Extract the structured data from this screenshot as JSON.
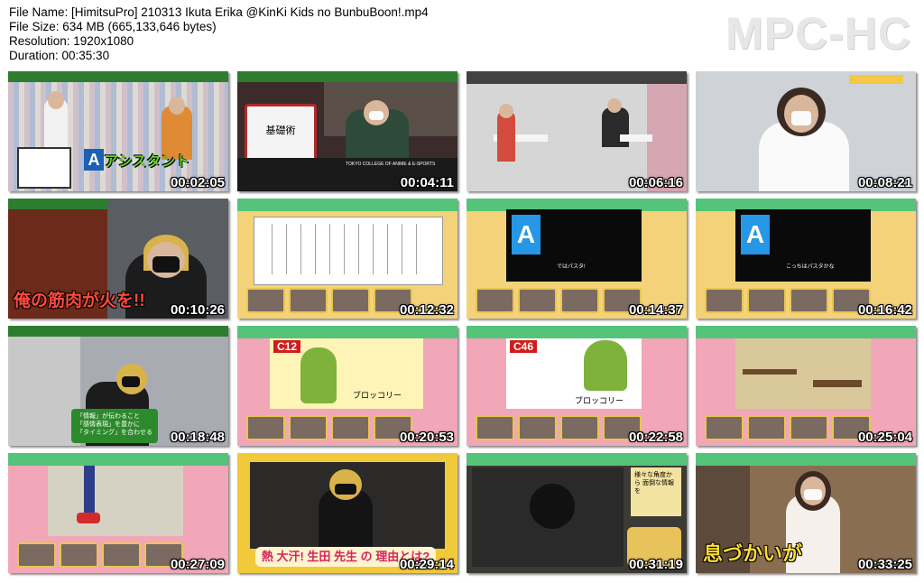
{
  "file_info": {
    "file_name": "File Name: [HimitsuPro] 210313 Ikuta Erika @KinKi Kids no BunbuBoon!.mp4",
    "file_size": "File Size: 634 MB (665,133,646 bytes)",
    "resolution": "Resolution: 1920x1080",
    "duration": "Duration: 00:35:30"
  },
  "logo": "MPC-HC",
  "thumbnails": [
    {
      "time": "00:02:05",
      "caption": "アシスタント",
      "letter": "A"
    },
    {
      "time": "00:04:11",
      "sign": "基礎術",
      "caption": "TOKYO COLLEGE OF ANIME & E-SPORTS"
    },
    {
      "time": "00:06:16"
    },
    {
      "time": "00:08:21"
    },
    {
      "time": "00:10:26",
      "caption": "俺の筋肉が火を!!"
    },
    {
      "time": "00:12:32"
    },
    {
      "time": "00:14:37",
      "letter": "A",
      "subtitle": "ではパスタ!"
    },
    {
      "time": "00:16:42",
      "letter": "A",
      "subtitle": "こっちはパスタかな"
    },
    {
      "time": "00:18:48",
      "lines": [
        "「情報」が伝わること",
        "「感情表現」を豊かに",
        "「タイミング」を合わせる"
      ]
    },
    {
      "time": "00:20:53",
      "cut": "C12",
      "label": "ブロッコリー"
    },
    {
      "time": "00:22:58",
      "cut": "C46",
      "label": "ブロッコリー"
    },
    {
      "time": "00:25:04"
    },
    {
      "time": "00:27:09"
    },
    {
      "time": "00:29:14",
      "caption": "熱 大汗! 生田 先生 の 理由とは?"
    },
    {
      "time": "00:31:19",
      "note": "様々な角度から 面倒な情報を"
    },
    {
      "time": "00:33:25",
      "caption": "息づかいが"
    }
  ]
}
